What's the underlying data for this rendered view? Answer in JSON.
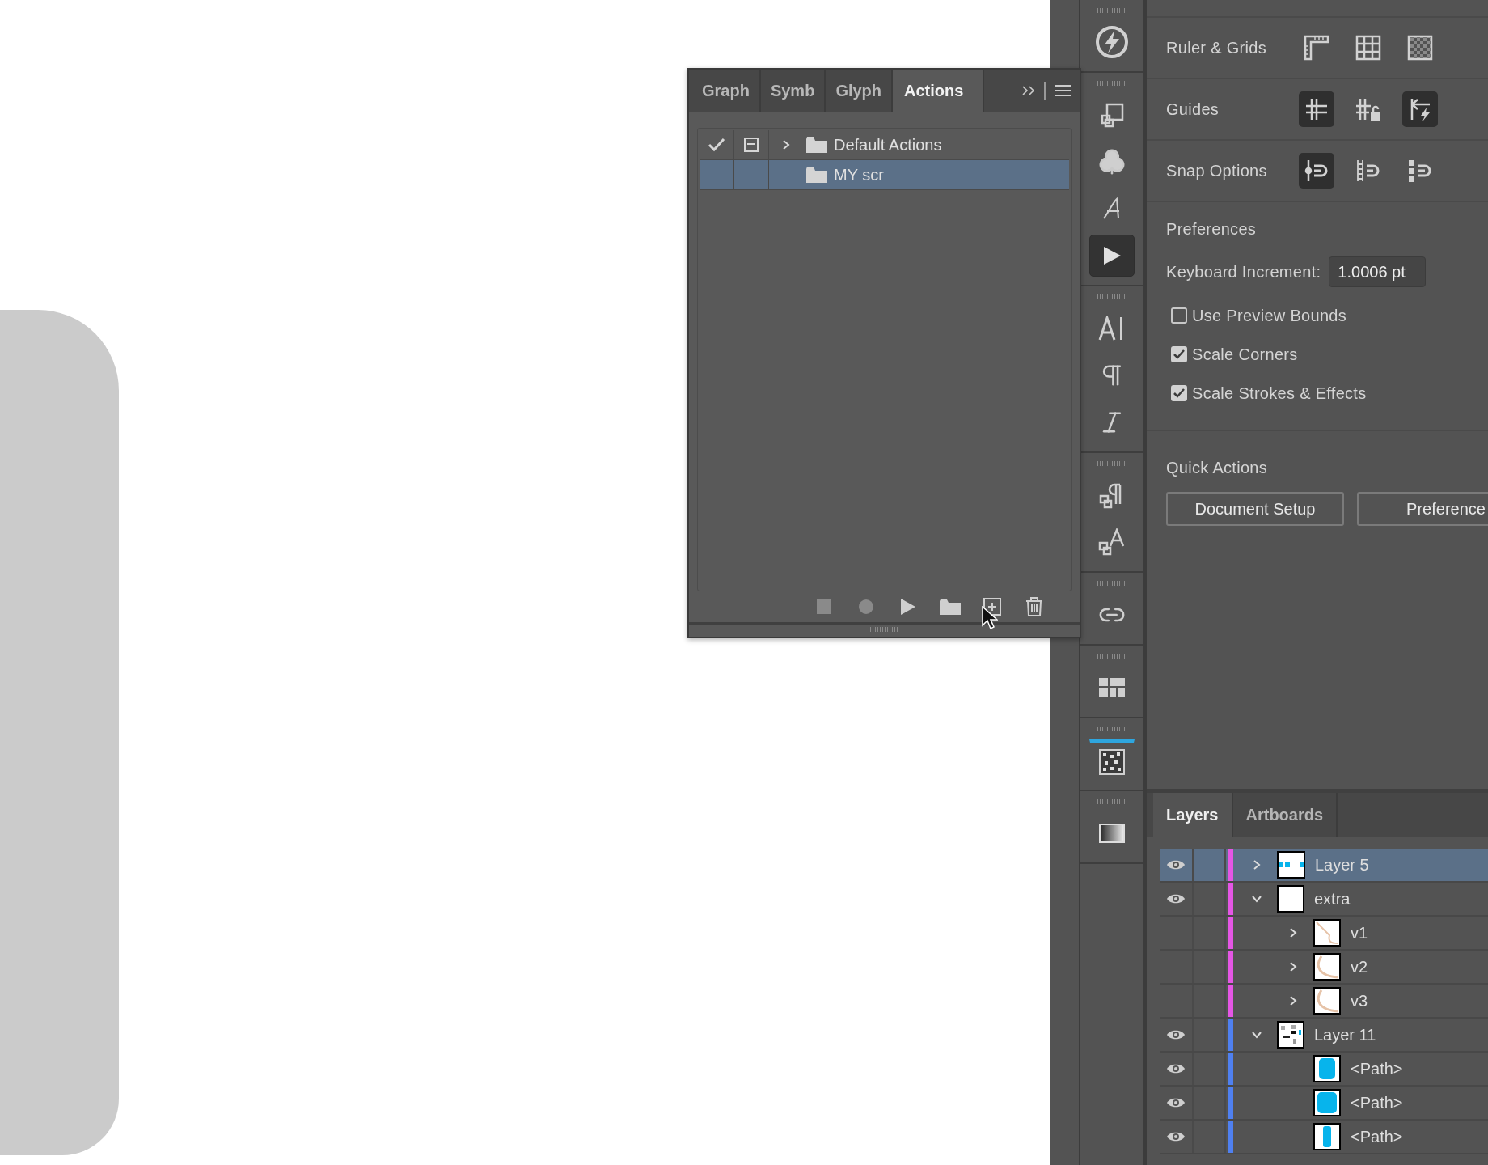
{
  "actions_panel": {
    "tabs": [
      {
        "label": "Graph",
        "selected": false
      },
      {
        "label": "Symb",
        "selected": false
      },
      {
        "label": "Glyph",
        "selected": false
      },
      {
        "label": "Actions",
        "selected": true
      }
    ],
    "rows": [
      {
        "name": "Default Actions",
        "enabled": true,
        "dialog": true,
        "expanded": false,
        "selected": false
      },
      {
        "name": "MY scr",
        "selected": true
      }
    ],
    "buttons": [
      {
        "kind": "stop",
        "disabled": true
      },
      {
        "kind": "record",
        "disabled": true
      },
      {
        "kind": "play",
        "disabled": false
      },
      {
        "kind": "new-set",
        "disabled": false
      },
      {
        "kind": "new-action",
        "disabled": false
      },
      {
        "kind": "delete",
        "disabled": false
      }
    ]
  },
  "toolbar": {
    "groups": [
      {
        "items": [
          {
            "kind": "bolt",
            "selected": false,
            "marked": false
          }
        ]
      },
      {
        "items": [
          {
            "kind": "boxes",
            "selected": false,
            "marked": false
          },
          {
            "kind": "club",
            "selected": false,
            "marked": false
          },
          {
            "kind": "script",
            "selected": false,
            "marked": false
          },
          {
            "kind": "play",
            "selected": true,
            "marked": false
          }
        ]
      },
      {
        "items": [
          {
            "kind": "type",
            "selected": false,
            "marked": false
          },
          {
            "kind": "pilcrow",
            "selected": false,
            "marked": false
          },
          {
            "kind": "italic",
            "selected": false,
            "marked": false
          }
        ]
      },
      {
        "items": [
          {
            "kind": "para-styles",
            "selected": false,
            "marked": false
          },
          {
            "kind": "char-styles",
            "selected": false,
            "marked": false
          }
        ]
      },
      {
        "items": [
          {
            "kind": "link",
            "selected": false,
            "marked": false
          }
        ]
      },
      {
        "items": [
          {
            "kind": "blocks",
            "selected": false,
            "marked": false
          }
        ]
      },
      {
        "items": [
          {
            "kind": "dotted",
            "selected": false,
            "marked": true
          }
        ]
      },
      {
        "items": [
          {
            "kind": "gradient",
            "selected": false,
            "marked": false
          }
        ]
      }
    ]
  },
  "properties": {
    "sections": [
      {
        "title": "Ruler & Grids",
        "buttons": [
          {
            "kind": "ruler",
            "on": false
          },
          {
            "kind": "grid",
            "on": false
          },
          {
            "kind": "checker",
            "on": false
          }
        ]
      },
      {
        "title": "Guides",
        "buttons": [
          {
            "kind": "guides",
            "on": true
          },
          {
            "kind": "guides-lock",
            "on": false
          },
          {
            "kind": "smart-guides",
            "on": true
          }
        ]
      },
      {
        "title": "Snap Options",
        "buttons": [
          {
            "kind": "snap-point",
            "on": true
          },
          {
            "kind": "snap-grid",
            "on": false
          },
          {
            "kind": "snap-pixel",
            "on": false
          }
        ]
      }
    ],
    "preferences": {
      "title": "Preferences",
      "keyboard_increment": {
        "label": "Keyboard Increment:",
        "value": "1.0006 pt"
      },
      "checkboxes": [
        {
          "label": "Use Preview Bounds",
          "checked": false
        },
        {
          "label": "Scale Corners",
          "checked": true
        },
        {
          "label": "Scale Strokes & Effects",
          "checked": true
        }
      ]
    },
    "quick_actions": {
      "title": "Quick Actions",
      "buttons": [
        "Document Setup",
        "Preference"
      ]
    }
  },
  "layers_panel": {
    "tabs": [
      {
        "label": "Layers",
        "selected": true
      },
      {
        "label": "Artboards",
        "selected": false
      }
    ],
    "layers": [
      {
        "name": "Layer 5",
        "visible": true,
        "expanded": false,
        "selected": true,
        "color": "#e556e5",
        "kind": "dots"
      },
      {
        "name": "extra",
        "visible": true,
        "expanded": true,
        "selected": false,
        "color": "#e556e5",
        "kind": "blank",
        "children": [
          {
            "name": "v1",
            "visible": false,
            "expanded": false,
            "selected": false,
            "color": "#e556e5",
            "kind": "stroke"
          },
          {
            "name": "v2",
            "visible": false,
            "expanded": false,
            "selected": false,
            "color": "#e556e5",
            "kind": "curve"
          },
          {
            "name": "v3",
            "visible": false,
            "expanded": false,
            "selected": false,
            "color": "#e556e5",
            "kind": "curve"
          }
        ]
      },
      {
        "name": "Layer 11",
        "visible": true,
        "expanded": true,
        "selected": false,
        "color": "#4f80f0",
        "kind": "mixed",
        "children": [
          {
            "name": "<Path>",
            "visible": true,
            "selected": false,
            "color": "#4f80f0",
            "kind": "fill-tall"
          },
          {
            "name": "<Path>",
            "visible": true,
            "selected": false,
            "color": "#4f80f0",
            "kind": "fill"
          },
          {
            "name": "<Path>",
            "visible": true,
            "selected": false,
            "color": "#4f80f0",
            "kind": "bar"
          }
        ]
      }
    ]
  }
}
